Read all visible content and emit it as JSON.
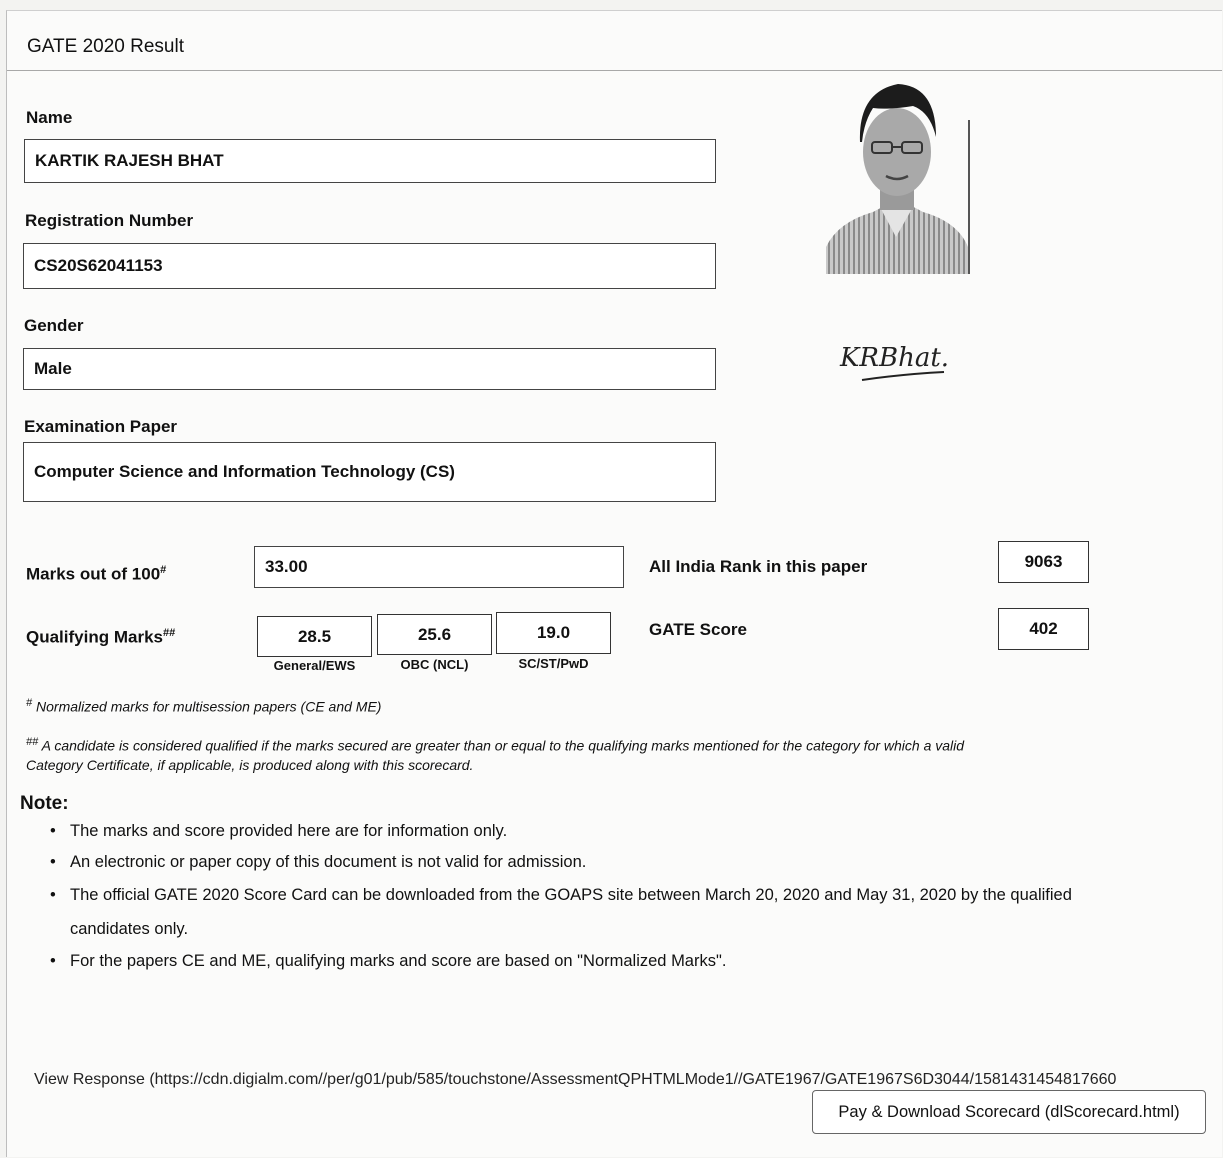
{
  "header": {
    "title": "GATE 2020 Result"
  },
  "fields": {
    "name_label": "Name",
    "name_value": "KARTIK RAJESH BHAT",
    "reg_label": "Registration Number",
    "reg_value": "CS20S62041153",
    "gender_label": "Gender",
    "gender_value": "Male",
    "paper_label": "Examination Paper",
    "paper_value": "Computer Science and Information Technology (CS)"
  },
  "marks": {
    "label": "Marks out of 100",
    "label_sup": "#",
    "value": "33.00"
  },
  "qualifying": {
    "label": "Qualifying Marks",
    "label_sup": "##",
    "categories": [
      {
        "value": "28.5",
        "name": "General/EWS"
      },
      {
        "value": "25.6",
        "name": "OBC (NCL)"
      },
      {
        "value": "19.0",
        "name": "SC/ST/PwD"
      }
    ]
  },
  "rank": {
    "label": "All India Rank in this paper",
    "value": "9063"
  },
  "score": {
    "label": "GATE Score",
    "value": "402"
  },
  "footnotes": {
    "one_mark": "#",
    "one": "Normalized marks for multisession papers (CE and ME)",
    "two_mark": "##",
    "two_line1": "A candidate is considered qualified if the marks secured are greater than or equal to the qualifying marks mentioned for the category for which a valid",
    "two_line2": "Category Certificate, if applicable, is produced along with this scorecard."
  },
  "note": {
    "title": "Note:",
    "items": [
      "The marks and score provided here are for information only.",
      "An electronic or paper copy of this document is not valid for admission.",
      "The official GATE 2020 Score Card can be downloaded from the GOAPS site between March 20, 2020 and May 31, 2020 by the qualified candidates only.",
      "For the papers CE and ME, qualifying marks and score are based on \"Normalized Marks\"."
    ]
  },
  "links": {
    "view_response": "View Response (https://cdn.digialm.com//per/g01/pub/585/touchstone/AssessmentQPHTMLMode1//GATE1967/GATE1967S6D3044/1581431454817660",
    "download_button": "Pay & Download Scorecard (dlScorecard.html)"
  },
  "signature": {
    "text": "KRBhat."
  },
  "icons": {
    "photo": "candidate-photo",
    "signature": "signature-image"
  }
}
